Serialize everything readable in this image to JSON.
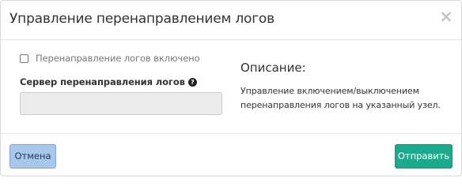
{
  "modal": {
    "title": "Управление перенаправлением логов",
    "close_glyph": "×"
  },
  "form": {
    "checkbox": {
      "label": "Перенаправление логов включено",
      "checked": false
    },
    "server": {
      "label": "Сервер перенаправления логов",
      "help_glyph": "?",
      "value": "",
      "placeholder": ""
    }
  },
  "description": {
    "heading": "Описание:",
    "text": "Управление включением/выключением перенаправления логов на указанный узел."
  },
  "footer": {
    "cancel_label": "Отмена",
    "submit_label": "Отправить"
  },
  "colors": {
    "submit": "#1aaa8c",
    "cancel": "#a9c7ea"
  },
  "icons": [
    "close-icon",
    "help-icon"
  ]
}
